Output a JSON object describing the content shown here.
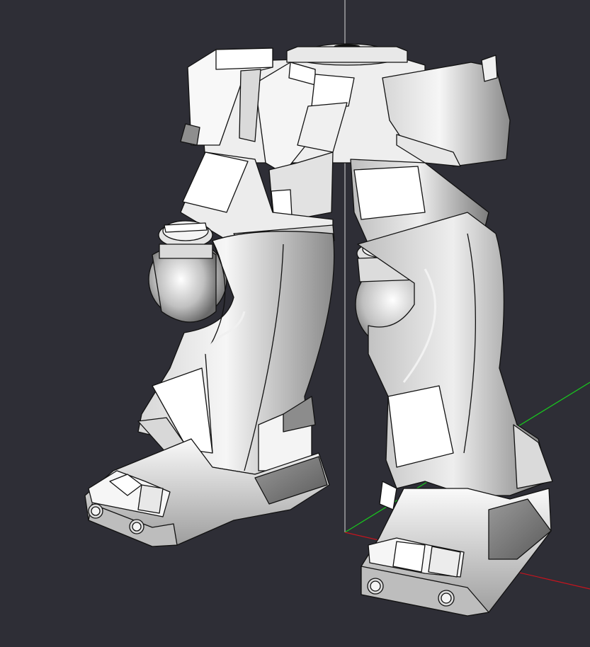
{
  "viewport": {
    "background_color": "#2e2e36",
    "model_fill_light": "#f4f4f4",
    "model_fill_mid": "#b8b8b8",
    "model_fill_dark": "#6e6e6e",
    "edge_color": "#111111"
  },
  "axes": {
    "x_axis_color": "#c8141e",
    "y_axis_color": "#18c81e",
    "z_axis_color": "#d8d8d8"
  }
}
